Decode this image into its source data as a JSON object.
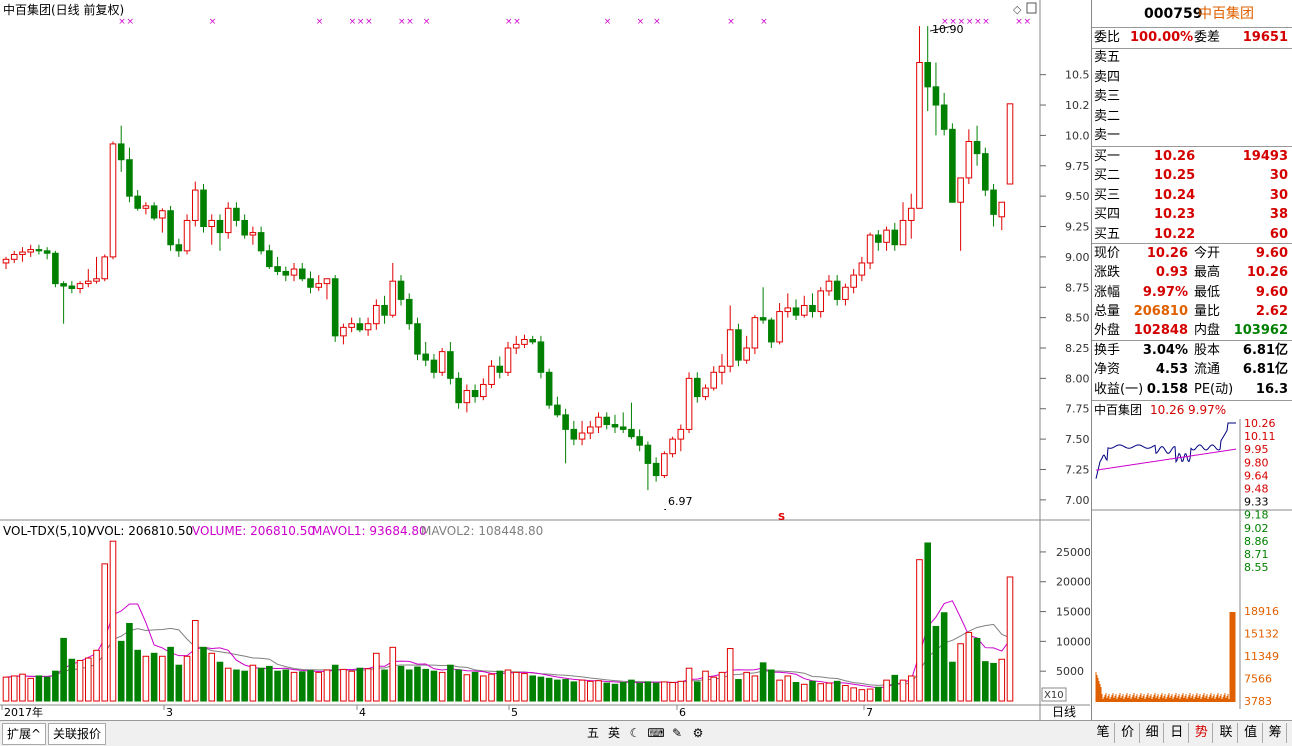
{
  "chart": {
    "title": "中百集团(日线 前复权)",
    "volume_legend": {
      "name": "VOL-TDX(5,10)",
      "vvol": "VVOL: 206810.50",
      "volume": "VOLUME: 206810.50",
      "mavol1": "MAVOL1: 93684.80",
      "mavol2": "MAVOL2: 108448.80"
    },
    "price_ticks": [
      "10.50",
      "10.25",
      "10.00",
      "9.75",
      "9.50",
      "9.25",
      "9.00",
      "8.75",
      "8.50",
      "8.25",
      "8.00",
      "7.75",
      "7.50",
      "7.25",
      "7.00"
    ],
    "volume_ticks": [
      "25000",
      "20000",
      "15000",
      "10000",
      "5000"
    ],
    "x10_label": "X10",
    "date_labels": [
      "2017年",
      "3",
      "4",
      "5",
      "6",
      "7"
    ],
    "high_label": "10.90",
    "low_label": "6.97",
    "s_marker": "S",
    "period_label": "日线",
    "colors": {
      "up": "#e00000",
      "down": "#008000",
      "ma1": "#cc00cc",
      "ma2": "#808080",
      "marker": "#cc00cc"
    }
  },
  "chart_data": {
    "type": "candlestick",
    "price_axis": {
      "min": 6.9,
      "max": 10.95
    },
    "volume_axis": {
      "min": 0,
      "max": 27000
    },
    "candles": [
      [
        8.95,
        9.0,
        8.9,
        8.98
      ],
      [
        8.98,
        9.05,
        8.95,
        9.02
      ],
      [
        9.02,
        9.08,
        8.96,
        9.04
      ],
      [
        9.04,
        9.1,
        9.0,
        9.06
      ],
      [
        9.06,
        9.1,
        9.02,
        9.05
      ],
      [
        9.05,
        9.08,
        8.98,
        9.03
      ],
      [
        9.03,
        9.05,
        8.75,
        8.78
      ],
      [
        8.78,
        8.8,
        8.45,
        8.76
      ],
      [
        8.76,
        8.8,
        8.7,
        8.74
      ],
      [
        8.74,
        8.8,
        8.7,
        8.78
      ],
      [
        8.78,
        8.9,
        8.75,
        8.8
      ],
      [
        8.8,
        9.0,
        8.78,
        8.82
      ],
      [
        8.82,
        9.02,
        8.8,
        9.0
      ],
      [
        9.0,
        9.95,
        8.98,
        9.93
      ],
      [
        9.93,
        10.08,
        9.7,
        9.8
      ],
      [
        9.8,
        9.9,
        9.45,
        9.5
      ],
      [
        9.5,
        9.55,
        9.38,
        9.4
      ],
      [
        9.4,
        9.45,
        9.35,
        9.42
      ],
      [
        9.42,
        9.45,
        9.3,
        9.32
      ],
      [
        9.32,
        9.4,
        9.2,
        9.38
      ],
      [
        9.38,
        9.42,
        9.05,
        9.1
      ],
      [
        9.1,
        9.15,
        9.0,
        9.05
      ],
      [
        9.05,
        9.35,
        9.02,
        9.3
      ],
      [
        9.3,
        9.62,
        9.25,
        9.55
      ],
      [
        9.55,
        9.6,
        9.2,
        9.25
      ],
      [
        9.25,
        9.35,
        9.1,
        9.3
      ],
      [
        9.3,
        9.35,
        9.05,
        9.2
      ],
      [
        9.2,
        9.45,
        9.15,
        9.4
      ],
      [
        9.4,
        9.45,
        9.25,
        9.3
      ],
      [
        9.3,
        9.35,
        9.15,
        9.18
      ],
      [
        9.18,
        9.25,
        9.1,
        9.2
      ],
      [
        9.2,
        9.25,
        9.02,
        9.05
      ],
      [
        9.05,
        9.1,
        8.9,
        8.92
      ],
      [
        8.92,
        9.0,
        8.85,
        8.88
      ],
      [
        8.88,
        8.92,
        8.8,
        8.85
      ],
      [
        8.85,
        8.95,
        8.8,
        8.9
      ],
      [
        8.9,
        8.95,
        8.8,
        8.82
      ],
      [
        8.82,
        8.88,
        8.7,
        8.75
      ],
      [
        8.75,
        8.85,
        8.72,
        8.78
      ],
      [
        8.78,
        8.82,
        8.65,
        8.82
      ],
      [
        8.82,
        8.85,
        8.3,
        8.35
      ],
      [
        8.35,
        8.45,
        8.28,
        8.42
      ],
      [
        8.42,
        8.5,
        8.38,
        8.45
      ],
      [
        8.45,
        8.5,
        8.38,
        8.4
      ],
      [
        8.4,
        8.5,
        8.35,
        8.45
      ],
      [
        8.45,
        8.65,
        8.4,
        8.6
      ],
      [
        8.6,
        8.68,
        8.45,
        8.52
      ],
      [
        8.52,
        8.95,
        8.5,
        8.8
      ],
      [
        8.8,
        8.85,
        8.6,
        8.65
      ],
      [
        8.65,
        8.7,
        8.4,
        8.45
      ],
      [
        8.45,
        8.5,
        8.15,
        8.2
      ],
      [
        8.2,
        8.3,
        8.1,
        8.15
      ],
      [
        8.15,
        8.2,
        8.0,
        8.05
      ],
      [
        8.05,
        8.25,
        8.02,
        8.22
      ],
      [
        8.22,
        8.3,
        7.95,
        8.0
      ],
      [
        8.0,
        8.05,
        7.75,
        7.8
      ],
      [
        7.8,
        7.95,
        7.72,
        7.9
      ],
      [
        7.9,
        7.95,
        7.8,
        7.85
      ],
      [
        7.85,
        8.0,
        7.82,
        7.95
      ],
      [
        7.95,
        8.15,
        7.92,
        8.1
      ],
      [
        8.1,
        8.18,
        8.0,
        8.05
      ],
      [
        8.05,
        8.3,
        8.02,
        8.25
      ],
      [
        8.25,
        8.35,
        8.2,
        8.28
      ],
      [
        8.28,
        8.36,
        8.25,
        8.32
      ],
      [
        8.32,
        8.35,
        8.28,
        8.3
      ],
      [
        8.3,
        8.35,
        8.0,
        8.05
      ],
      [
        8.05,
        8.08,
        7.75,
        7.78
      ],
      [
        7.78,
        7.85,
        7.68,
        7.7
      ],
      [
        7.7,
        7.75,
        7.3,
        7.58
      ],
      [
        7.58,
        7.65,
        7.45,
        7.5
      ],
      [
        7.5,
        7.65,
        7.45,
        7.55
      ],
      [
        7.55,
        7.65,
        7.5,
        7.6
      ],
      [
        7.6,
        7.72,
        7.55,
        7.68
      ],
      [
        7.68,
        7.72,
        7.58,
        7.62
      ],
      [
        7.62,
        7.7,
        7.55,
        7.6
      ],
      [
        7.6,
        7.72,
        7.55,
        7.58
      ],
      [
        7.58,
        7.8,
        7.5,
        7.52
      ],
      [
        7.52,
        7.58,
        7.4,
        7.45
      ],
      [
        7.45,
        7.48,
        7.08,
        7.3
      ],
      [
        7.3,
        7.35,
        7.15,
        7.2
      ],
      [
        7.2,
        7.4,
        7.18,
        7.38
      ],
      [
        7.38,
        7.52,
        7.35,
        7.5
      ],
      [
        7.5,
        7.62,
        7.4,
        7.58
      ],
      [
        7.58,
        8.05,
        7.55,
        8.0
      ],
      [
        8.0,
        8.05,
        7.8,
        7.85
      ],
      [
        7.85,
        7.95,
        7.82,
        7.92
      ],
      [
        7.92,
        8.1,
        7.9,
        8.05
      ],
      [
        8.05,
        8.2,
        7.95,
        8.1
      ],
      [
        8.1,
        8.6,
        8.05,
        8.4
      ],
      [
        8.4,
        8.45,
        8.1,
        8.15
      ],
      [
        8.15,
        8.35,
        8.12,
        8.25
      ],
      [
        8.25,
        8.52,
        8.2,
        8.5
      ],
      [
        8.5,
        8.75,
        8.45,
        8.48
      ],
      [
        8.48,
        8.5,
        8.25,
        8.3
      ],
      [
        8.3,
        8.62,
        8.28,
        8.55
      ],
      [
        8.55,
        8.7,
        8.5,
        8.58
      ],
      [
        8.58,
        8.65,
        8.48,
        8.52
      ],
      [
        8.52,
        8.68,
        8.5,
        8.6
      ],
      [
        8.6,
        8.7,
        8.5,
        8.55
      ],
      [
        8.55,
        8.75,
        8.5,
        8.72
      ],
      [
        8.72,
        8.85,
        8.68,
        8.8
      ],
      [
        8.8,
        8.85,
        8.6,
        8.65
      ],
      [
        8.65,
        8.78,
        8.6,
        8.75
      ],
      [
        8.75,
        8.9,
        8.7,
        8.85
      ],
      [
        8.85,
        9.0,
        8.8,
        8.95
      ],
      [
        8.95,
        9.2,
        8.9,
        9.18
      ],
      [
        9.18,
        9.22,
        9.05,
        9.12
      ],
      [
        9.12,
        9.25,
        9.05,
        9.22
      ],
      [
        9.22,
        9.28,
        9.05,
        9.1
      ],
      [
        9.1,
        9.45,
        9.1,
        9.3
      ],
      [
        9.3,
        9.52,
        9.15,
        9.4
      ],
      [
        9.4,
        10.9,
        9.4,
        10.6
      ],
      [
        10.6,
        10.9,
        10.2,
        10.4
      ],
      [
        10.4,
        10.6,
        10.0,
        10.25
      ],
      [
        10.25,
        10.35,
        10.0,
        10.05
      ],
      [
        10.05,
        10.1,
        9.45,
        9.45
      ],
      [
        9.45,
        9.6,
        9.05,
        9.65
      ],
      [
        9.65,
        10.05,
        9.6,
        9.95
      ],
      [
        9.95,
        10.08,
        9.75,
        9.85
      ],
      [
        9.85,
        9.9,
        9.5,
        9.55
      ],
      [
        9.55,
        9.6,
        9.25,
        9.35
      ],
      [
        9.33,
        9.4,
        9.22,
        9.45
      ],
      [
        9.6,
        10.26,
        9.6,
        10.26
      ]
    ],
    "volumes": [
      4000,
      4200,
      4500,
      3800,
      4200,
      4000,
      5000,
      10500,
      7000,
      6800,
      7200,
      8500,
      23000,
      26800,
      10000,
      13000,
      8500,
      7500,
      8000,
      7500,
      9000,
      6000,
      7500,
      13500,
      9000,
      8000,
      6500,
      5500,
      5200,
      5000,
      6000,
      5500,
      5800,
      5000,
      5200,
      4800,
      4900,
      5100,
      4800,
      5200,
      6000,
      5300,
      5000,
      5500,
      5400,
      8000,
      5200,
      9000,
      5800,
      5200,
      5700,
      5300,
      5000,
      4800,
      6000,
      5200,
      4400,
      4800,
      4200,
      4500,
      5000,
      5200,
      4800,
      4600,
      4200,
      4000,
      3800,
      3500,
      3600,
      3200,
      3500,
      3300,
      3400,
      3000,
      2800,
      3100,
      3500,
      3000,
      3200,
      3000,
      3200,
      3100,
      3300,
      5500,
      3200,
      5000,
      4000,
      4800,
      8800,
      3600,
      4800,
      4200,
      6400,
      5200,
      3500,
      4200,
      3100,
      2800,
      3300,
      2900,
      3000,
      3300,
      2600,
      2200,
      1900,
      2000,
      2300,
      3500,
      4300,
      3500,
      4200,
      23700,
      26500,
      12500,
      14800,
      6500,
      9600,
      11500,
      10500,
      6600,
      6300,
      7000,
      20800
    ],
    "ma1": [],
    "ma2": [],
    "high": {
      "index": 115,
      "value": 10.9
    },
    "low": {
      "index": 80,
      "value": 6.97
    },
    "marker_indices": [
      14,
      15,
      25,
      38,
      42,
      43,
      44,
      48,
      49,
      51,
      61,
      62,
      73,
      77,
      79,
      88,
      92,
      114,
      115,
      116,
      117,
      118,
      119,
      123,
      124
    ]
  },
  "quote": {
    "code": "000759",
    "name": "中百集团",
    "weibi_label": "委比",
    "weibi_value": "100.00%",
    "weicha_label": "委差",
    "weicha_value": "19651",
    "sell_labels": [
      "卖五",
      "卖四",
      "卖三",
      "卖二",
      "卖一"
    ],
    "buy": [
      {
        "label": "买一",
        "price": "10.26",
        "vol": "19493"
      },
      {
        "label": "买二",
        "price": "10.25",
        "vol": "30"
      },
      {
        "label": "买三",
        "price": "10.24",
        "vol": "30"
      },
      {
        "label": "买四",
        "price": "10.23",
        "vol": "38"
      },
      {
        "label": "买五",
        "price": "10.22",
        "vol": "60"
      }
    ],
    "stats": [
      {
        "l1": "现价",
        "v1": "10.26",
        "c1": "red",
        "l2": "今开",
        "v2": "9.60",
        "c2": "red"
      },
      {
        "l1": "涨跌",
        "v1": "0.93",
        "c1": "red",
        "l2": "最高",
        "v2": "10.26",
        "c2": "red"
      },
      {
        "l1": "涨幅",
        "v1": "9.97%",
        "c1": "red",
        "l2": "最低",
        "v2": "9.60",
        "c2": "red"
      },
      {
        "l1": "总量",
        "v1": "206810",
        "c1": "orange",
        "l2": "量比",
        "v2": "2.62",
        "c2": "red"
      },
      {
        "l1": "外盘",
        "v1": "102848",
        "c1": "red",
        "l2": "内盘",
        "v2": "103962",
        "c2": "grn"
      }
    ],
    "fund": [
      {
        "l1": "换手",
        "v1": "3.04%",
        "l2": "股本",
        "v2": "6.81亿"
      },
      {
        "l1": "净资",
        "v1": "4.53",
        "l2": "流通",
        "v2": "6.81亿"
      },
      {
        "l1": "收益(一)",
        "v1": "0.158",
        "l2": "PE(动)",
        "v2": "16.3"
      }
    ]
  },
  "mini": {
    "name": "中百集团",
    "price": "10.26",
    "pct": "9.97%",
    "price_ticks": [
      "10.26",
      "10.11",
      "9.95",
      "9.80",
      "9.64",
      "9.48",
      "9.33",
      "9.18",
      "9.02",
      "8.86",
      "8.71",
      "8.55"
    ],
    "vol_ticks": [
      "18916",
      "15132",
      "11349",
      "7566",
      "3783"
    ]
  },
  "bottom": {
    "tabs_left": [
      "扩展^",
      "关联报价"
    ],
    "tools": [
      "五",
      "英",
      "☾",
      "⌨",
      "✎",
      "⚙"
    ],
    "tabs_right": [
      "笔",
      "价",
      "细",
      "日",
      "势",
      "联",
      "值",
      "筹"
    ]
  }
}
